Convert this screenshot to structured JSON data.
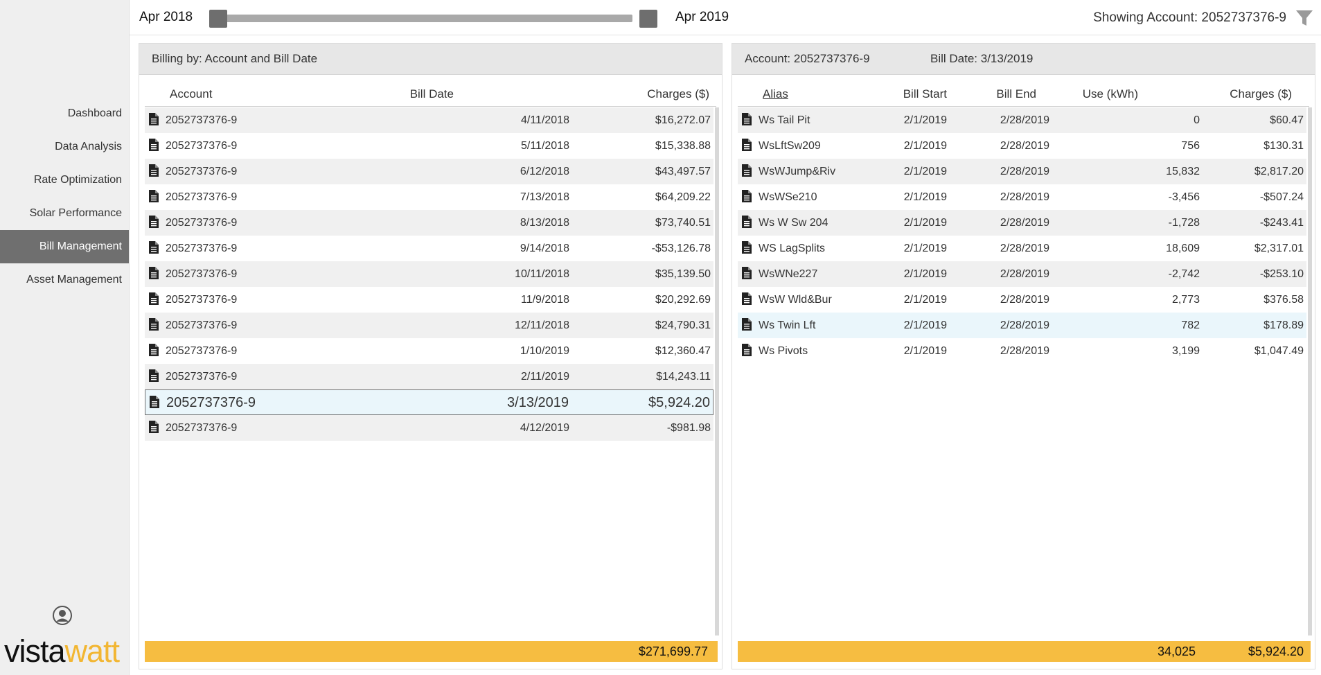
{
  "nav": {
    "items": [
      "Dashboard",
      "Data Analysis",
      "Rate Optimization",
      "Solar Performance",
      "Bill Management",
      "Asset Management"
    ],
    "active": "Bill Management"
  },
  "logo": {
    "part1": "vista",
    "part2": "watt"
  },
  "topbar": {
    "range_start": "Apr 2018",
    "range_end": "Apr 2019",
    "showing_account": "Showing Account: 2052737376-9"
  },
  "left_panel": {
    "title": "Billing by: Account and Bill Date",
    "columns": {
      "account": "Account",
      "bill_date": "Bill Date",
      "charges": "Charges ($)"
    },
    "rows": [
      {
        "account": "2052737376-9",
        "bill_date": "4/11/2018",
        "charges": "$16,272.07"
      },
      {
        "account": "2052737376-9",
        "bill_date": "5/11/2018",
        "charges": "$15,338.88"
      },
      {
        "account": "2052737376-9",
        "bill_date": "6/12/2018",
        "charges": "$43,497.57"
      },
      {
        "account": "2052737376-9",
        "bill_date": "7/13/2018",
        "charges": "$64,209.22"
      },
      {
        "account": "2052737376-9",
        "bill_date": "8/13/2018",
        "charges": "$73,740.51"
      },
      {
        "account": "2052737376-9",
        "bill_date": "9/14/2018",
        "charges": "-$53,126.78"
      },
      {
        "account": "2052737376-9",
        "bill_date": "10/11/2018",
        "charges": "$35,139.50"
      },
      {
        "account": "2052737376-9",
        "bill_date": "11/9/2018",
        "charges": "$20,292.69"
      },
      {
        "account": "2052737376-9",
        "bill_date": "12/11/2018",
        "charges": "$24,790.31"
      },
      {
        "account": "2052737376-9",
        "bill_date": "1/10/2019",
        "charges": "$12,360.47"
      },
      {
        "account": "2052737376-9",
        "bill_date": "2/11/2019",
        "charges": "$14,243.11"
      },
      {
        "account": "2052737376-9",
        "bill_date": "3/13/2019",
        "charges": "$5,924.20"
      },
      {
        "account": "2052737376-9",
        "bill_date": "4/12/2019",
        "charges": "-$981.98"
      }
    ],
    "selected_row": "3/13/2019",
    "total_charges": "$271,699.77"
  },
  "right_panel": {
    "account_label": "Account: 2052737376-9",
    "bill_date_label": "Bill Date: 3/13/2019",
    "columns": {
      "alias": "Alias",
      "bill_start": "Bill Start",
      "bill_end": "Bill End",
      "use": "Use (kWh)",
      "charges": "Charges ($)"
    },
    "rows": [
      {
        "alias": "Ws Tail Pit",
        "bill_start": "2/1/2019",
        "bill_end": "2/28/2019",
        "use": "0",
        "charges": "$60.47"
      },
      {
        "alias": "WsLftSw209",
        "bill_start": "2/1/2019",
        "bill_end": "2/28/2019",
        "use": "756",
        "charges": "$130.31"
      },
      {
        "alias": "WsWJump&Riv",
        "bill_start": "2/1/2019",
        "bill_end": "2/28/2019",
        "use": "15,832",
        "charges": "$2,817.20"
      },
      {
        "alias": "WsWSe210",
        "bill_start": "2/1/2019",
        "bill_end": "2/28/2019",
        "use": "-3,456",
        "charges": "-$507.24"
      },
      {
        "alias": "Ws W Sw 204",
        "bill_start": "2/1/2019",
        "bill_end": "2/28/2019",
        "use": "-1,728",
        "charges": "-$243.41"
      },
      {
        "alias": "WS LagSplits",
        "bill_start": "2/1/2019",
        "bill_end": "2/28/2019",
        "use": "18,609",
        "charges": "$2,317.01"
      },
      {
        "alias": "WsWNe227",
        "bill_start": "2/1/2019",
        "bill_end": "2/28/2019",
        "use": "-2,742",
        "charges": "-$253.10"
      },
      {
        "alias": "WsW Wld&Bur",
        "bill_start": "2/1/2019",
        "bill_end": "2/28/2019",
        "use": "2,773",
        "charges": "$376.58"
      },
      {
        "alias": "Ws Twin Lft",
        "bill_start": "2/1/2019",
        "bill_end": "2/28/2019",
        "use": "782",
        "charges": "$178.89"
      },
      {
        "alias": "Ws Pivots",
        "bill_start": "2/1/2019",
        "bill_end": "2/28/2019",
        "use": "3,199",
        "charges": "$1,047.49"
      }
    ],
    "highlighted_row": "Ws Twin Lft",
    "total_use": "34,025",
    "total_charges": "$5,924.20"
  }
}
